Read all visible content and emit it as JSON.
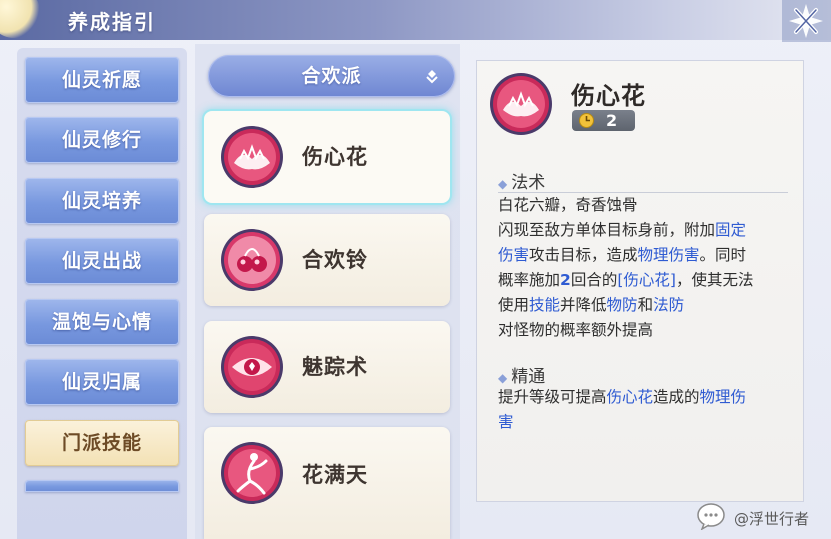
{
  "header": {
    "title": "养成指引"
  },
  "left_nav": {
    "items": [
      {
        "label": "仙灵祈愿",
        "active": false
      },
      {
        "label": "仙灵修行",
        "active": false
      },
      {
        "label": "仙灵培养",
        "active": false
      },
      {
        "label": "仙灵出战",
        "active": false
      },
      {
        "label": "温饱与心情",
        "active": false
      },
      {
        "label": "仙灵归属",
        "active": false
      },
      {
        "label": "门派技能",
        "active": true
      }
    ]
  },
  "middle": {
    "dropdown": {
      "selected": "合欢派",
      "icon": "chevron-down-icon"
    },
    "skills": [
      {
        "name": "伤心花",
        "icon": "lotus-icon",
        "selected": true
      },
      {
        "name": "合欢铃",
        "icon": "bell-icon",
        "selected": false
      },
      {
        "name": "魅踪术",
        "icon": "eye-icon",
        "selected": false
      },
      {
        "name": "花满天",
        "icon": "dancer-icon",
        "selected": false
      }
    ]
  },
  "detail": {
    "name": "伤心花",
    "cost": "2",
    "cost_icon": "clock-icon",
    "section1_title": "法术",
    "desc": {
      "line1": "白花六瓣，奇香蚀骨",
      "l2a": "闪现至敌方单体目标身前，附加",
      "l2b": "固定",
      "l3a": "伤害",
      "l3b": "攻击目标，造成",
      "l3c": "物理伤害",
      "l3d": "。同时",
      "l4a": "概率施加",
      "l4b": "2",
      "l4c": "回合的",
      "l4d": "[伤心花]",
      "l4e": "，使其无法",
      "l5a": "使用",
      "l5b": "技能",
      "l5c": "并降低",
      "l5d": "物防",
      "l5e": "和",
      "l5f": "法防",
      "line6": "对怪物的概率额外提高"
    },
    "section2_title": "精通",
    "mastery": {
      "a": "提升等级可提高",
      "b": "伤心花",
      "c": "造成的",
      "d": "物理伤",
      "e": "害"
    }
  },
  "watermark": {
    "text": "@浮世行者",
    "icon": "wechat-bubble-icon"
  },
  "colors": {
    "accent_blue": "#2f5bd2",
    "nav_blue": "#7898df",
    "nav_active": "#f3e1b4"
  }
}
